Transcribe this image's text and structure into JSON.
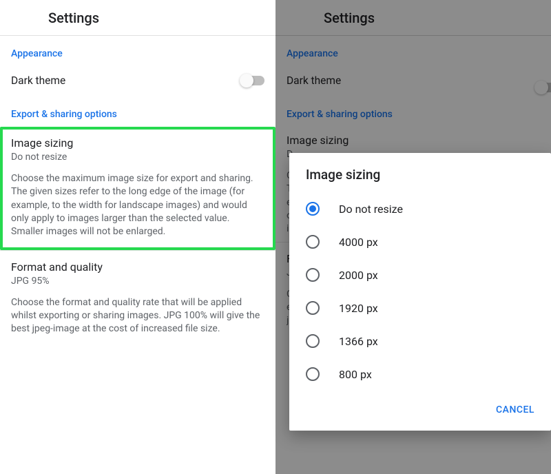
{
  "header": {
    "title": "Settings"
  },
  "sections": {
    "appearance": {
      "label": "Appearance"
    },
    "export": {
      "label": "Export & sharing options"
    }
  },
  "dark_theme": {
    "label": "Dark theme",
    "enabled": false
  },
  "image_sizing": {
    "title": "Image sizing",
    "value": "Do not resize",
    "description": "Choose the maximum image size for export and sharing. The given sizes refer to the long edge of the image (for example, to the width for landscape images) and would only apply to images larger than the selected value. Smaller images will not be enlarged."
  },
  "format_quality": {
    "title": "Format and quality",
    "value": "JPG 95%",
    "description": "Choose the format and quality rate that will be applied whilst exporting or sharing images. JPG 100% will give the best jpeg-image at the cost of increased file size."
  },
  "right_trunc": {
    "image_sizing_value": "D",
    "desc_l1": "C",
    "desc_l2": "T",
    "desc_l3": "e",
    "desc_l4": "o",
    "desc_l5": "in",
    "format_title": "F",
    "format_value": "J",
    "format_desc_l1": "C",
    "format_desc_l2": "e",
    "format_desc_l3": "jp"
  },
  "dialog": {
    "title": "Image sizing",
    "options": [
      {
        "label": "Do not resize",
        "selected": true
      },
      {
        "label": "4000 px",
        "selected": false
      },
      {
        "label": "2000 px",
        "selected": false
      },
      {
        "label": "1920 px",
        "selected": false
      },
      {
        "label": "1366 px",
        "selected": false
      },
      {
        "label": "800 px",
        "selected": false
      }
    ],
    "cancel": "CANCEL"
  }
}
